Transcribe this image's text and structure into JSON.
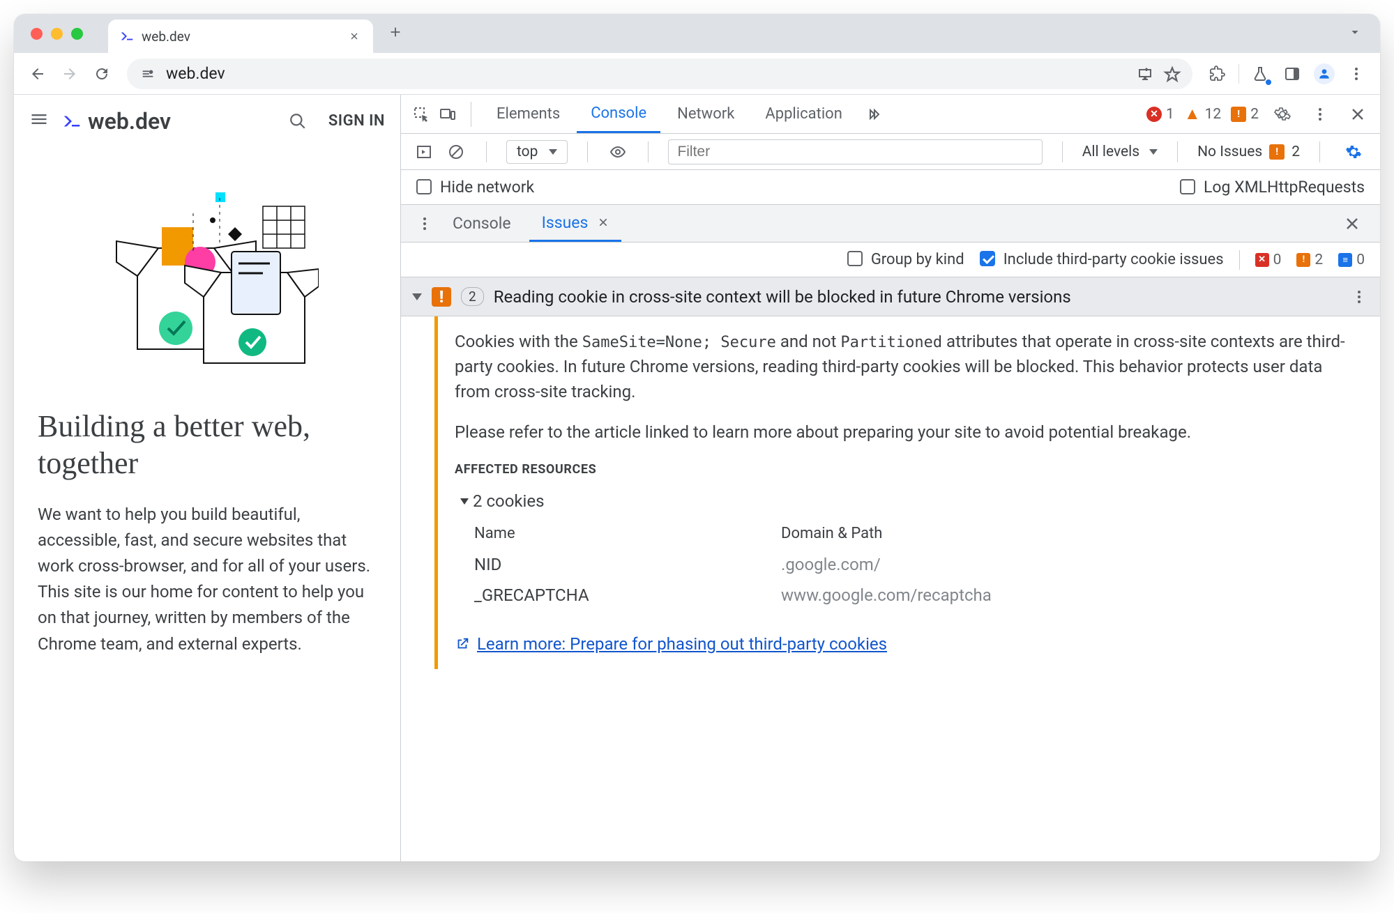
{
  "browser": {
    "tab_title": "web.dev",
    "url": "web.dev"
  },
  "site": {
    "name": "web.dev",
    "signin": "SIGN IN",
    "hero_title": "Building a better web, together",
    "hero_body": "We want to help you build beautiful, accessible, fast, and secure websites that work cross-browser, and for all of your users. This site is our home for content to help you on that journey, written by members of the Chrome team, and external experts."
  },
  "devtools": {
    "tabs": {
      "elements": "Elements",
      "console": "Console",
      "network": "Network",
      "application": "Application"
    },
    "counts": {
      "errors": "1",
      "warnings": "12",
      "flags": "2"
    },
    "console_toolbar": {
      "context": "top",
      "filter_placeholder": "Filter",
      "levels": "All levels",
      "no_issues": "No Issues",
      "no_issues_flag_count": "2"
    },
    "check_row": {
      "hide_network": "Hide network",
      "log_xhr": "Log XMLHttpRequests"
    },
    "drawer": {
      "tab_console": "Console",
      "tab_issues": "Issues"
    },
    "issues_toolbar": {
      "group_by_kind": "Group by kind",
      "include_3p": "Include third-party cookie issues",
      "counts": {
        "red": "0",
        "orange": "2",
        "blue": "0"
      }
    },
    "issue": {
      "count": "2",
      "title": "Reading cookie in cross-site context will be blocked in future Chrome versions",
      "para1_pre": "Cookies with the ",
      "para1_code1": "SameSite=None; Secure",
      "para1_mid": " and not ",
      "para1_code2": "Partitioned",
      "para1_post": " attributes that operate in cross-site contexts are third-party cookies. In future Chrome versions, reading third-party cookies will be blocked. This behavior protects user data from cross-site tracking.",
      "para2": "Please refer to the article linked to learn more about preparing your site to avoid potential breakage.",
      "affected_label": "AFFECTED RESOURCES",
      "cookies_toggle": "2 cookies",
      "col_name": "Name",
      "col_domain": "Domain & Path",
      "rows": [
        {
          "name": "NID",
          "domain": ".google.com/"
        },
        {
          "name": "_GRECAPTCHA",
          "domain": "www.google.com/recaptcha"
        }
      ],
      "learn_more": "Learn more: Prepare for phasing out third-party cookies"
    }
  }
}
